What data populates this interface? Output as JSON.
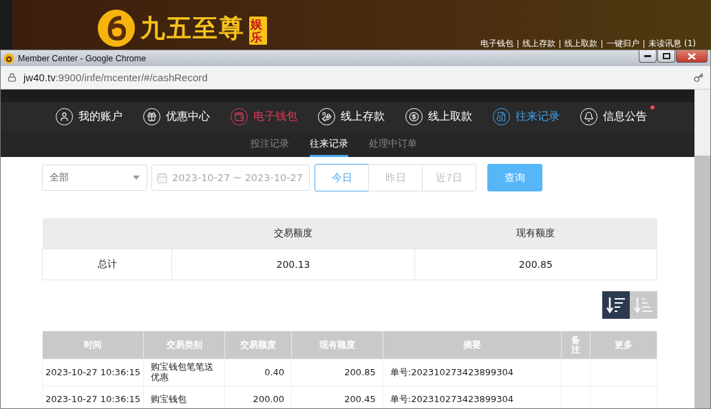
{
  "site": {
    "logo": {
      "name": "九五至尊",
      "tag": "娱乐"
    },
    "links": [
      "电子钱包",
      "线上存款",
      "线上取款",
      "一键归户",
      "未读讯息 (1)"
    ]
  },
  "window": {
    "title": "Member Center - Google Chrome",
    "url_host": "jw40.tv",
    "url_path": ":9900/infe/mcenter/#/cashRecord"
  },
  "nav": {
    "items": [
      {
        "label": "我的账户",
        "color": "#ffffff",
        "badge": false
      },
      {
        "label": "优惠中心",
        "color": "#ffffff",
        "badge": false
      },
      {
        "label": "电子钱包",
        "color": "#e8385a",
        "badge": false
      },
      {
        "label": "线上存款",
        "color": "#ffffff",
        "badge": false
      },
      {
        "label": "线上取款",
        "color": "#ffffff",
        "badge": false
      },
      {
        "label": "往来记录",
        "color": "#3fa4f0",
        "badge": false
      },
      {
        "label": "信息公告",
        "color": "#ffffff",
        "badge": true
      }
    ]
  },
  "subtabs": [
    {
      "label": "投注记录",
      "selected": false
    },
    {
      "label": "往来记录",
      "selected": true
    },
    {
      "label": "处理中订单",
      "selected": false
    }
  ],
  "filters": {
    "type_select": "全部",
    "date_range": "2023-10-27 ~ 2023-10-27",
    "quick_ranges": [
      {
        "label": "今日",
        "selected": true
      },
      {
        "label": "昨日",
        "selected": false
      },
      {
        "label": "近7日",
        "selected": false
      }
    ],
    "query_button": "查询"
  },
  "summary": {
    "columns": [
      "交易额度",
      "现有额度"
    ],
    "rows": [
      {
        "label": "总计",
        "values": [
          "200.13",
          "200.85"
        ]
      }
    ]
  },
  "sort_buttons": [
    {
      "kind": "desc",
      "selected": true
    },
    {
      "kind": "asc",
      "selected": false
    }
  ],
  "records": {
    "columns": [
      "时间",
      "交易类别",
      "交易额度",
      "现有额度",
      "摘要",
      "备注",
      "更多"
    ],
    "rows": [
      {
        "cells": [
          "2023-10-27 10:36:15",
          "购宝钱包笔笔送优惠",
          "0.40",
          "200.85",
          "单号:202310273423899304",
          "",
          ""
        ]
      },
      {
        "cells": [
          "2023-10-27 10:36:15",
          "购宝钱包",
          "200.00",
          "200.45",
          "单号:202310273423899304",
          "",
          ""
        ]
      }
    ]
  }
}
